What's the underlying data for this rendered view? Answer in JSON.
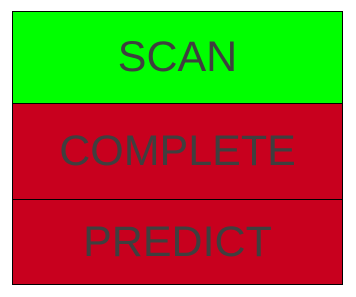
{
  "steps": [
    {
      "label": "SCAN",
      "state": "active",
      "color": "#00ff00"
    },
    {
      "label": "COMPLETE",
      "state": "inactive",
      "color": "#c8001e"
    },
    {
      "label": "PREDICT",
      "state": "inactive",
      "color": "#c8001e"
    }
  ],
  "text_color": "#3f3f3f"
}
